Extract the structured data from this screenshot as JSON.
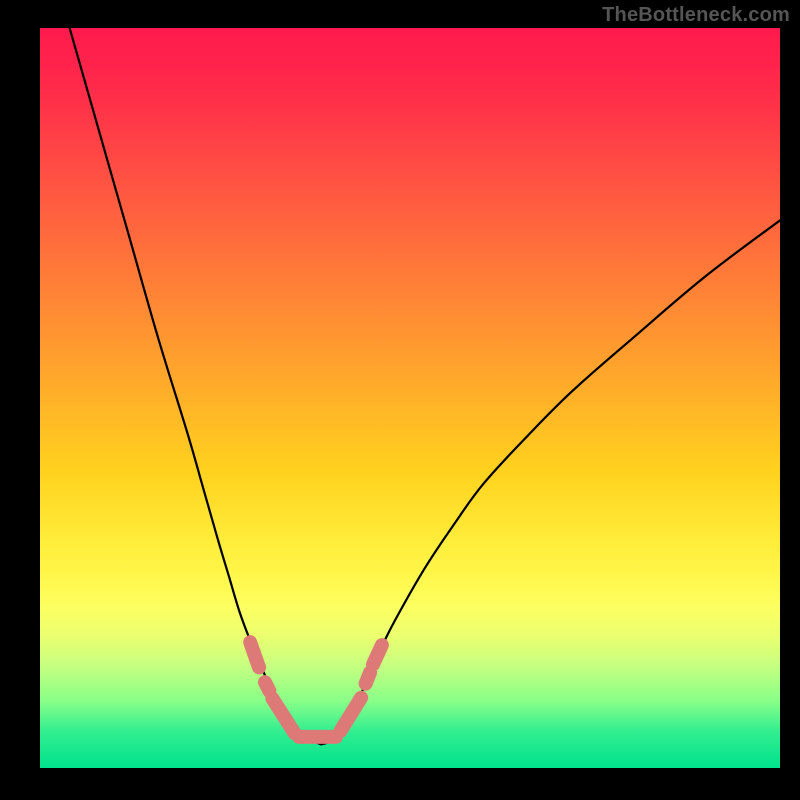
{
  "watermark": "TheBottleneck.com",
  "chart_data": {
    "type": "line",
    "title": "",
    "xlabel": "",
    "ylabel": "",
    "xlim": [
      0,
      100
    ],
    "ylim": [
      0,
      100
    ],
    "series": [
      {
        "name": "left-curve",
        "x": [
          4,
          8,
          12,
          16,
          20,
          22,
          24,
          25.5,
          27,
          28.5,
          30,
          31,
          32,
          33,
          34,
          35,
          36,
          37,
          38
        ],
        "y": [
          100,
          86,
          72,
          58,
          45,
          38,
          31,
          26,
          21,
          17,
          13.5,
          11,
          9,
          7.5,
          6,
          5,
          4.2,
          3.6,
          3.2
        ]
      },
      {
        "name": "right-curve",
        "x": [
          38,
          39,
          40,
          41,
          42,
          43,
          44,
          46,
          48,
          52,
          56,
          60,
          66,
          72,
          80,
          90,
          100
        ],
        "y": [
          3.2,
          3.5,
          4.2,
          5.3,
          7,
          9,
          11.5,
          16,
          20,
          27,
          33,
          38.5,
          45,
          51,
          58,
          66.5,
          74
        ]
      }
    ],
    "markers": {
      "name": "highlight-segments",
      "color": "#dd7a78",
      "segments": [
        {
          "x1": 28.4,
          "y1": 17.0,
          "x2": 29.6,
          "y2": 13.6
        },
        {
          "x1": 30.4,
          "y1": 11.6,
          "x2": 31.0,
          "y2": 10.4
        },
        {
          "x1": 31.4,
          "y1": 9.4,
          "x2": 34.4,
          "y2": 4.7
        },
        {
          "x1": 35.0,
          "y1": 4.2,
          "x2": 40.0,
          "y2": 4.2
        },
        {
          "x1": 40.6,
          "y1": 5.0,
          "x2": 43.4,
          "y2": 9.5
        },
        {
          "x1": 44.0,
          "y1": 11.4,
          "x2": 44.6,
          "y2": 12.9
        },
        {
          "x1": 45.0,
          "y1": 14.0,
          "x2": 46.2,
          "y2": 16.6
        }
      ]
    },
    "gradient_stops": [
      {
        "pos": 0,
        "color": "#ff1a4d"
      },
      {
        "pos": 50,
        "color": "#ffb128"
      },
      {
        "pos": 78,
        "color": "#fdff60"
      },
      {
        "pos": 100,
        "color": "#00e28c"
      }
    ]
  }
}
